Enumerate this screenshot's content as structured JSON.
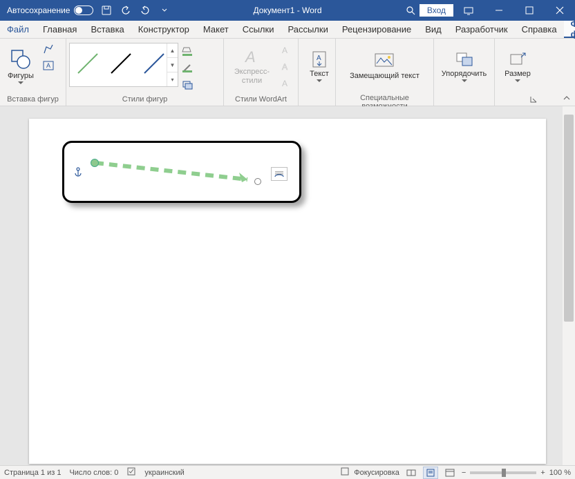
{
  "titlebar": {
    "autosave": "Автосохранение",
    "docTitle": "Документ1 - Word",
    "login": "Вход"
  },
  "tabs": {
    "file": "Файл",
    "home": "Главная",
    "insert": "Вставка",
    "design": "Конструктор",
    "layout": "Макет",
    "references": "Ссылки",
    "mailings": "Рассылки",
    "review": "Рецензирование",
    "view": "Вид",
    "developer": "Разработчик",
    "help": "Справка",
    "format": "Формат фиг"
  },
  "ribbon": {
    "insertShapes": {
      "shapes": "Фигуры",
      "groupLabel": "Вставка фигур"
    },
    "shapeStyles": {
      "groupLabel": "Стили фигур"
    },
    "wordArt": {
      "express": "Экспресс-стили",
      "groupLabel": "Стили WordArt"
    },
    "text": {
      "text": "Текст"
    },
    "accessibility": {
      "altText": "Замещающий текст",
      "groupLabel": "Специальные возможности"
    },
    "arrange": {
      "arrange": "Упорядочить"
    },
    "size": {
      "size": "Размер"
    }
  },
  "status": {
    "page": "Страница 1 из 1",
    "words": "Число слов: 0",
    "lang": "украинский",
    "focus": "Фокусировка",
    "zoomMinus": "−",
    "zoomPlus": "+",
    "zoom": "100 %"
  }
}
